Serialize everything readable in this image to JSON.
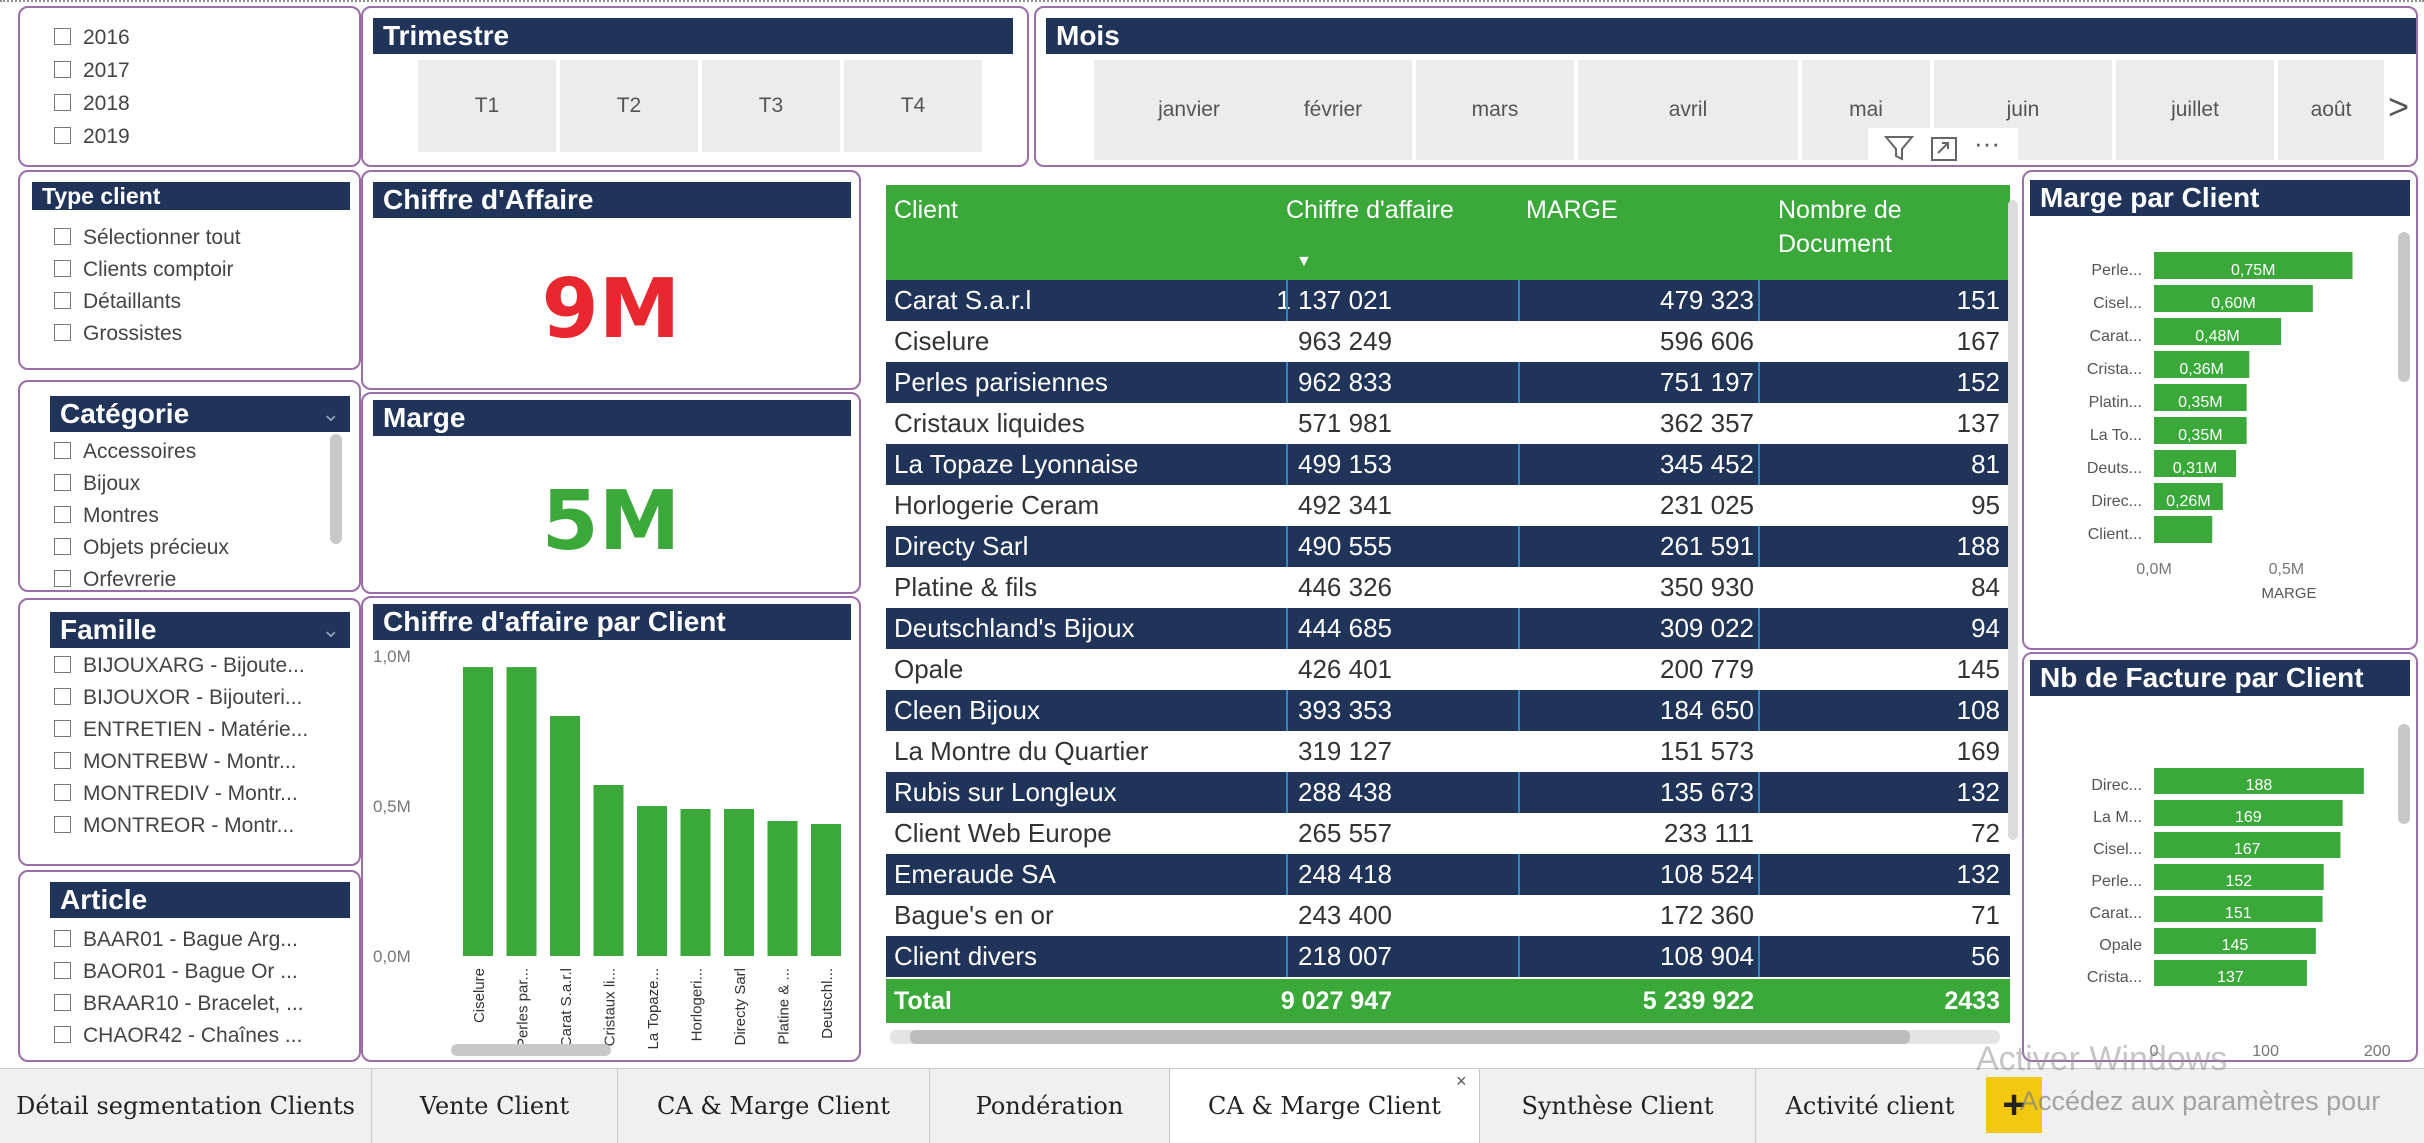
{
  "years": [
    "2016",
    "2017",
    "2018",
    "2019"
  ],
  "trimestre": {
    "title": "Trimestre",
    "items": [
      "T1",
      "T2",
      "T3",
      "T4"
    ]
  },
  "mois": {
    "title": "Mois",
    "items": [
      "janvier",
      "février",
      "mars",
      "avril",
      "mai",
      "juin",
      "juillet",
      "août"
    ],
    "next_glyph": ">",
    "more_glyph": "···"
  },
  "type_client": {
    "title": "Type client",
    "items": [
      "Sélectionner tout",
      "Clients comptoir",
      "Détaillants",
      "Grossistes"
    ]
  },
  "categorie": {
    "title": "Catégorie",
    "items": [
      "Accessoires",
      "Bijoux",
      "Montres",
      "Objets précieux",
      "Orfevrerie"
    ]
  },
  "famille": {
    "title": "Famille",
    "items": [
      "BIJOUXARG - Bijoute...",
      "BIJOUXOR - Bijouteri...",
      "ENTRETIEN - Matérie...",
      "MONTREBW - Montr...",
      "MONTREDIV - Montr...",
      "MONTREOR - Montr..."
    ]
  },
  "article": {
    "title": "Article",
    "items": [
      "BAAR01 - Bague Arg...",
      "BAOR01 - Bague Or ...",
      "BRAAR10 - Bracelet, ...",
      "CHAOR42 - Chaînes ..."
    ]
  },
  "kpi_ca": {
    "title": "Chiffre d'Affaire",
    "value": "9M",
    "color": "#e8282e"
  },
  "kpi_marge": {
    "title": "Marge",
    "value": "5M",
    "color": "#3aa93a"
  },
  "table": {
    "headers": [
      "Client",
      "Chiffre d'affaire",
      "MARGE",
      "Nombre de Document"
    ],
    "rows": [
      [
        "Carat S.a.r.l",
        "1 137 021",
        "479 323",
        "151"
      ],
      [
        "Ciselure",
        "963 249",
        "596 606",
        "167"
      ],
      [
        "Perles parisiennes",
        "962 833",
        "751 197",
        "152"
      ],
      [
        "Cristaux liquides",
        "571 981",
        "362 357",
        "137"
      ],
      [
        "La Topaze Lyonnaise",
        "499 153",
        "345 452",
        "81"
      ],
      [
        "Horlogerie Ceram",
        "492 341",
        "231 025",
        "95"
      ],
      [
        "Directy Sarl",
        "490 555",
        "261 591",
        "188"
      ],
      [
        "Platine & fils",
        "446 326",
        "350 930",
        "84"
      ],
      [
        "Deutschland's Bijoux",
        "444 685",
        "309 022",
        "94"
      ],
      [
        "Opale",
        "426 401",
        "200 779",
        "145"
      ],
      [
        "Cleen Bijoux",
        "393 353",
        "184 650",
        "108"
      ],
      [
        "La Montre du Quartier",
        "319 127",
        "151 573",
        "169"
      ],
      [
        "Rubis sur Longleux",
        "288 438",
        "135 673",
        "132"
      ],
      [
        "Client Web Europe",
        "265 557",
        "233 111",
        "72"
      ],
      [
        "Emeraude SA",
        "248 418",
        "108 524",
        "132"
      ],
      [
        "Bague's en or",
        "243 400",
        "172 360",
        "71"
      ],
      [
        "Client divers",
        "218 007",
        "108 904",
        "56"
      ]
    ],
    "total": [
      "Total",
      "9 027 947",
      "5 239 922",
      "2433"
    ]
  },
  "chart_data": [
    {
      "type": "bar",
      "title": "Chiffre d'affaire par Client",
      "categories": [
        "Ciselure",
        "Perles par...",
        "Carat S.a.r.l",
        "Cristaux li...",
        "La Topaze...",
        "Horlogeri...",
        "Directy Sarl",
        "Platine & ...",
        "Deutschl..."
      ],
      "values": [
        0.963,
        0.963,
        0.8,
        0.57,
        0.5,
        0.49,
        0.49,
        0.45,
        0.44
      ],
      "yticks": [
        "1,0M",
        "0,5M",
        "0,0M"
      ],
      "ylim": [
        0,
        1.0
      ],
      "color": "#3aa93a"
    },
    {
      "type": "bar",
      "orientation": "horizontal",
      "title": "Marge par Client",
      "categories": [
        "Perle...",
        "Cisel...",
        "Carat...",
        "Crista...",
        "Platin...",
        "La To...",
        "Deuts...",
        "Direc...",
        "Client..."
      ],
      "values": [
        0.75,
        0.6,
        0.48,
        0.36,
        0.35,
        0.35,
        0.31,
        0.26,
        0.22
      ],
      "labels": [
        "0,75M",
        "0,60M",
        "0,48M",
        "0,36M",
        "0,35M",
        "0,35M",
        "0,31M",
        "0,26M",
        ""
      ],
      "xticks": [
        "0,0M",
        "0,5M"
      ],
      "xlabel": "MARGE",
      "xlim": [
        0,
        0.85
      ],
      "color": "#3aa93a"
    },
    {
      "type": "bar",
      "orientation": "horizontal",
      "title": "Nb de Facture par Client",
      "categories": [
        "Direc...",
        "La M...",
        "Cisel...",
        "Perle...",
        "Carat...",
        "Opale",
        "Crista..."
      ],
      "values": [
        188,
        169,
        167,
        152,
        151,
        145,
        137
      ],
      "labels": [
        "188",
        "169",
        "167",
        "152",
        "151",
        "145",
        "137"
      ],
      "xticks": [
        "0",
        "100",
        "200"
      ],
      "xlim": [
        0,
        215
      ],
      "color": "#3aa93a"
    }
  ],
  "tabs": [
    "Détail segmentation Clients",
    "Vente Client",
    "CA & Marge Client",
    "Pondération",
    "CA & Marge Client",
    "Synthèse Client",
    "Activité client"
  ],
  "tab_add": "+",
  "tab_close": "×",
  "watermark": {
    "line1": "Activer Windows",
    "line2": "Accédez aux paramètres pour"
  },
  "colors": {
    "navy": "#1f3458",
    "green": "#3aa93a",
    "border": "#9b6ea8",
    "red": "#e8282e"
  }
}
